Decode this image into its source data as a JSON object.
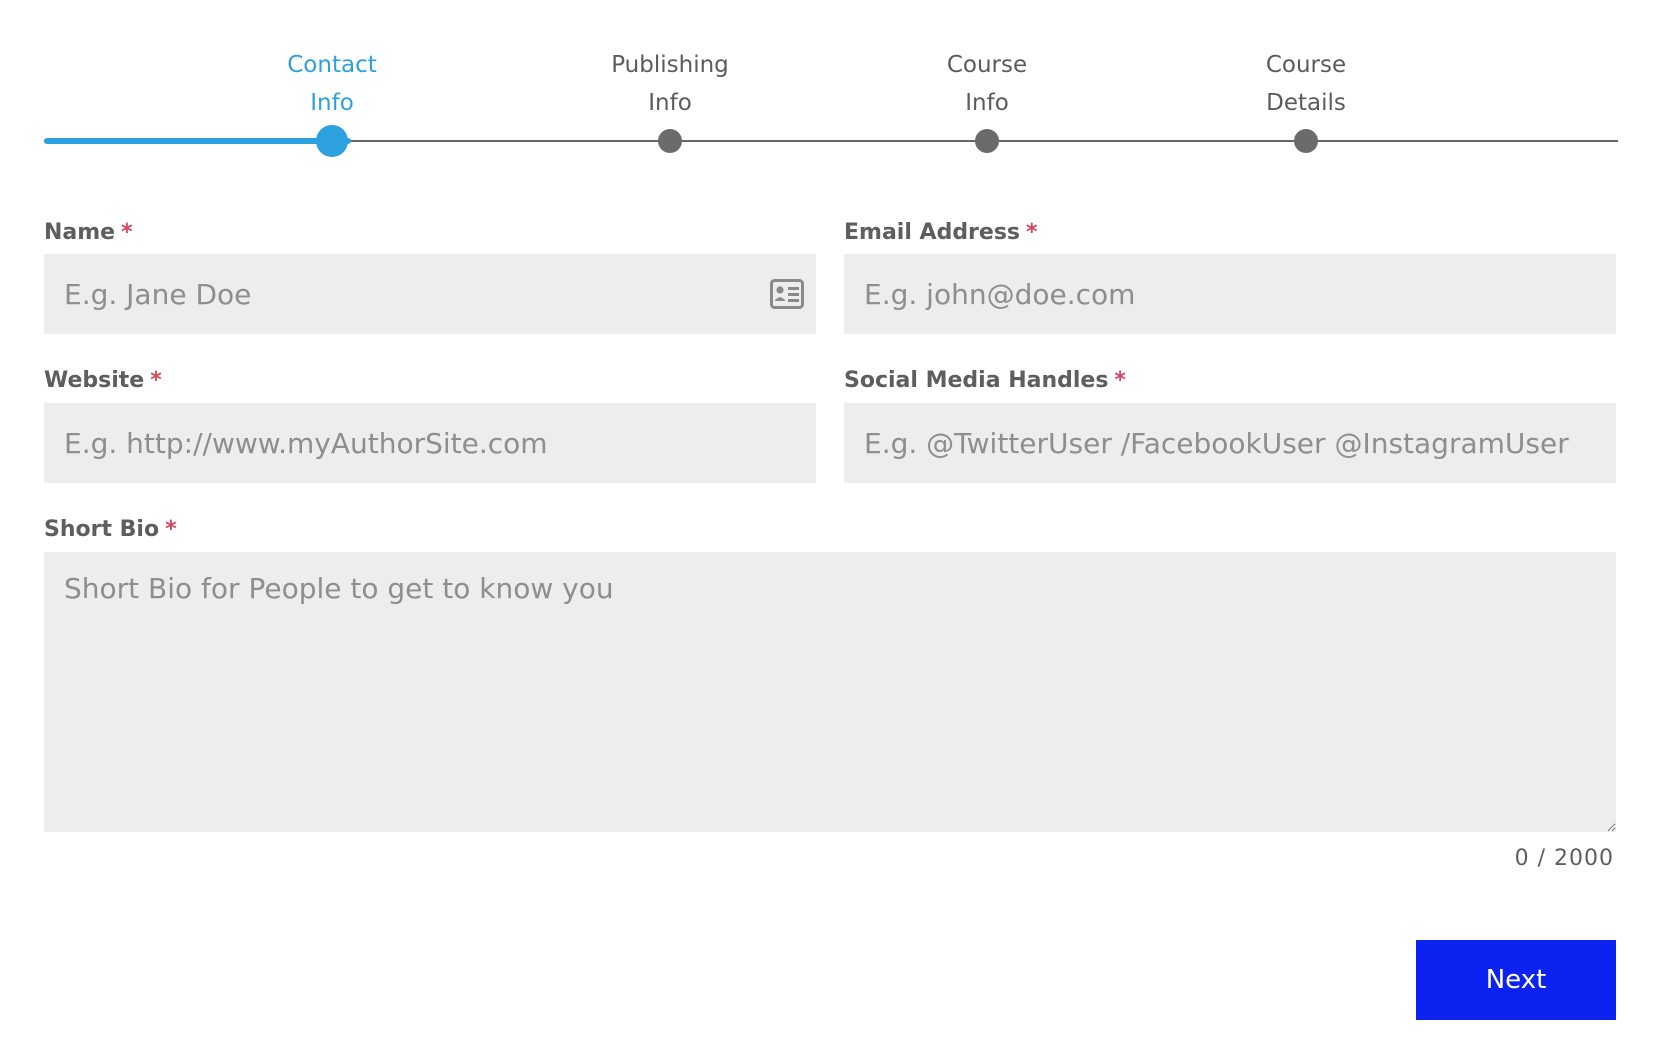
{
  "stepper": {
    "steps": [
      {
        "label": "Contact\nInfo",
        "active": true
      },
      {
        "label": "Publishing\nInfo",
        "active": false
      },
      {
        "label": "Course\nInfo",
        "active": false
      },
      {
        "label": "Course\nDetails",
        "active": false
      }
    ],
    "active_color": "#2da1e0",
    "inactive_color": "#6b6b6b"
  },
  "form": {
    "required_marker": "*",
    "name": {
      "label": "Name",
      "placeholder": "E.g. Jane Doe",
      "value": ""
    },
    "email": {
      "label": "Email Address",
      "placeholder": "E.g. john@doe.com",
      "value": ""
    },
    "website": {
      "label": "Website",
      "placeholder": "E.g. http://www.myAuthorSite.com",
      "value": ""
    },
    "social": {
      "label": "Social Media Handles",
      "placeholder": "E.g. @TwitterUser /FacebookUser @InstagramUser",
      "value": ""
    },
    "bio": {
      "label": "Short Bio",
      "placeholder": "Short Bio for People to get to know you",
      "value": "",
      "counter": "0 / 2000"
    }
  },
  "actions": {
    "next_label": "Next",
    "next_color": "#0b22f0"
  },
  "icons": {
    "name_field_icon": "contact-card-icon"
  }
}
